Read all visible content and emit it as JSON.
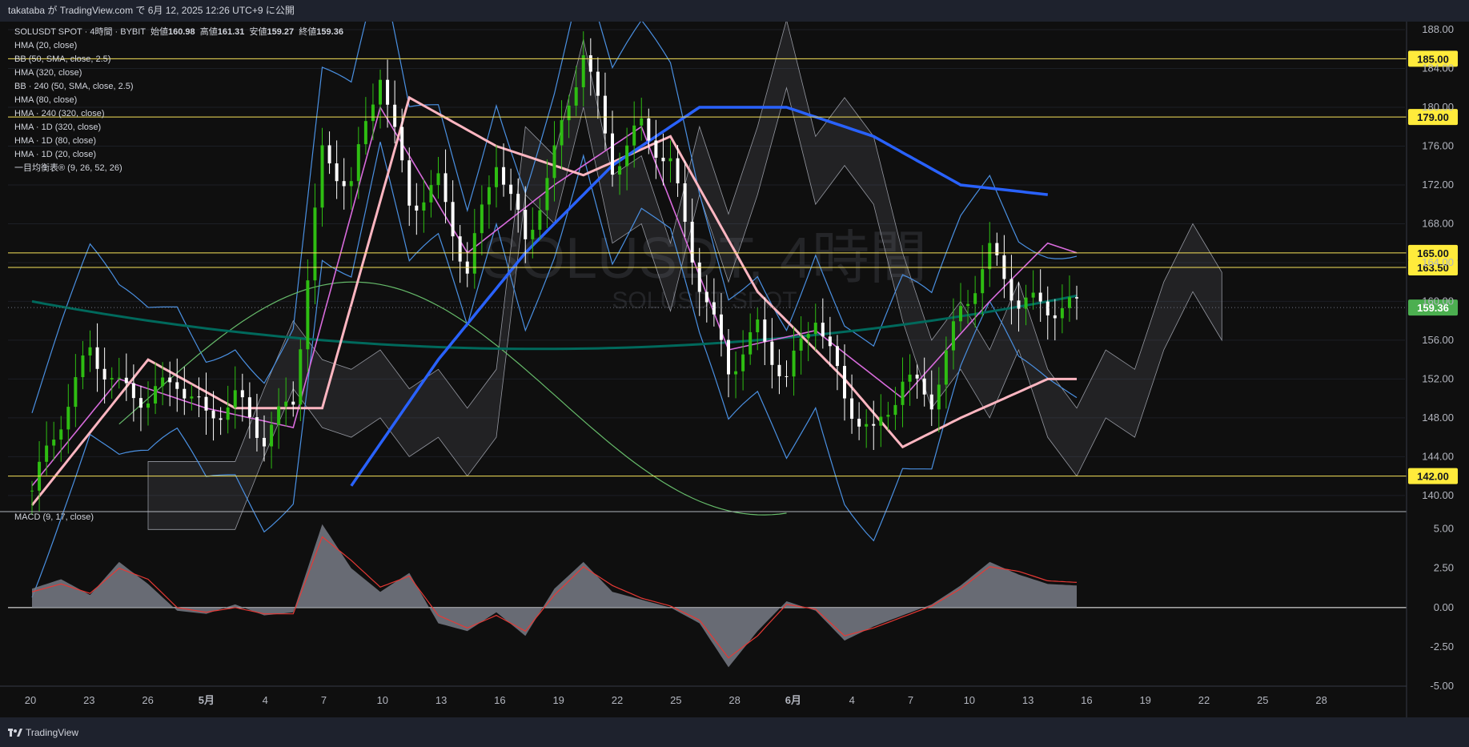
{
  "header": {
    "publish_line": "takataba が TradingView.com で 6月 12, 2025 12:26 UTC+9 に公開"
  },
  "legend": {
    "symbol_line": "SOLUSDT SPOT · 4時間 · BYBIT",
    "open_label": "始値",
    "open": "160.98",
    "high_label": "高値",
    "high": "161.31",
    "low_label": "安値",
    "low": "159.27",
    "close_label": "終値",
    "close": "159.36",
    "indicators": [
      "HMA (20, close)",
      "BB (50, SMA, close, 2.5)",
      "HMA (320, close)",
      "BB · 240 (50, SMA, close, 2.5)",
      "HMA (80, close)",
      "HMA · 240 (320, close)",
      "HMA · 1D (320, close)",
      "HMA · 1D (80, close)",
      "HMA · 1D (20, close)",
      "一目均衡表® (9, 26, 52, 26)"
    ]
  },
  "watermark": {
    "main": "SOLUSDT, 4時間",
    "sub": "SOLUSDT SPOT"
  },
  "footer": {
    "brand": "TradingView"
  },
  "colors": {
    "up": "#2ebd12",
    "down": "#ffffff",
    "level": "#f7e35b",
    "level_label_bg": "#ffeb3b",
    "last_price_bg": "#4caf50",
    "hma20": "#d86bdc",
    "hma80": "#ffb6c1",
    "hma320": "#2962ff",
    "bb": "#4a90e2",
    "bb240": "#5c8fd6",
    "green": "#66bb6a",
    "teal": "#00695c",
    "macd_fill": "#787b86",
    "signal": "#e53935"
  },
  "chart_data": [
    {
      "type": "candlestick",
      "title": "SOLUSDT SPOT · 4時間 · BYBIT",
      "x_tick_labels": [
        "20",
        "23",
        "26",
        "5月",
        "4",
        "7",
        "10",
        "13",
        "16",
        "19",
        "22",
        "25",
        "28",
        "6月",
        "4",
        "7",
        "10",
        "13",
        "16",
        "19",
        "22",
        "25",
        "28"
      ],
      "y_tick_labels": [
        "188.00",
        "184.00",
        "180.00",
        "176.00",
        "172.00",
        "168.00",
        "164.00",
        "160.00",
        "156.00",
        "152.00",
        "148.00",
        "144.00",
        "140.00"
      ],
      "ylim": [
        139,
        188
      ],
      "horizontal_levels": [
        185.0,
        179.0,
        165.0,
        163.5,
        142.0
      ],
      "horizontal_level_labels": [
        "185.00",
        "179.00",
        "165.00",
        "163.50",
        "142.00"
      ],
      "last_price": 159.36,
      "last_price_label": "159.36",
      "close_path": {
        "x": [
          0,
          2,
          4,
          6,
          8,
          10,
          12,
          14,
          16,
          18,
          20,
          22,
          24,
          26,
          28,
          30,
          32,
          34,
          36,
          38,
          40,
          42,
          44,
          46,
          48,
          50,
          52,
          54,
          56,
          58,
          60,
          62,
          64,
          66,
          68,
          70,
          72
        ],
        "y": [
          140.5,
          148,
          155,
          151,
          150,
          152,
          148,
          150,
          146,
          150,
          175,
          172,
          184,
          170,
          172,
          163,
          175,
          166,
          175,
          186,
          174,
          178,
          174,
          162,
          153,
          157,
          152,
          159,
          150,
          146,
          152,
          150,
          159,
          165,
          160,
          159.4,
          159.36
        ]
      },
      "series": [
        {
          "name": "HMA (20, close)",
          "x": [
            0,
            6,
            12,
            18,
            24,
            30,
            36,
            42,
            48,
            54,
            60,
            66,
            70,
            72
          ],
          "y": [
            141,
            152,
            149,
            147,
            180,
            165,
            172,
            178,
            155,
            157,
            150,
            160,
            166,
            165
          ]
        },
        {
          "name": "HMA (80, close)",
          "x": [
            0,
            8,
            14,
            20,
            26,
            32,
            38,
            44,
            50,
            56,
            60,
            64,
            70,
            72
          ],
          "y": [
            139,
            154,
            149,
            149,
            181,
            176,
            173,
            177,
            161,
            152,
            145,
            148,
            152,
            152
          ]
        },
        {
          "name": "HMA (320, close)",
          "x": [
            22,
            28,
            34,
            40,
            46,
            52,
            58,
            64,
            70
          ],
          "y": [
            141,
            154,
            165,
            174,
            180,
            180,
            177,
            172,
            171
          ]
        }
      ]
    },
    {
      "type": "area",
      "title": "MACD (9, 17, close)",
      "y_tick_labels": [
        "5.00",
        "2.50",
        "0.00",
        "-2.50",
        "-5.00"
      ],
      "ylim": [
        -5,
        6
      ],
      "series": [
        {
          "name": "MACD (9, 17, close)",
          "x": [
            0,
            2,
            4,
            6,
            8,
            10,
            12,
            14,
            16,
            18,
            20,
            22,
            24,
            26,
            28,
            30,
            32,
            34,
            36,
            38,
            40,
            42,
            44,
            46,
            48,
            50,
            52,
            54,
            56,
            58,
            60,
            62,
            64,
            66,
            68,
            70,
            72
          ],
          "y": [
            1.2,
            1.8,
            0.8,
            2.9,
            1.5,
            -0.2,
            -0.4,
            0.2,
            -0.5,
            -0.3,
            5.3,
            2.5,
            1.0,
            2.2,
            -1.0,
            -1.5,
            -0.3,
            -1.8,
            1.2,
            2.9,
            1.0,
            0.5,
            0.0,
            -1.0,
            -3.8,
            -1.5,
            0.4,
            -0.2,
            -2.1,
            -1.2,
            -0.5,
            0.2,
            1.4,
            2.9,
            2.1,
            1.5,
            1.4
          ]
        },
        {
          "name": "signal",
          "x": [
            0,
            2,
            4,
            6,
            8,
            10,
            12,
            14,
            16,
            18,
            20,
            22,
            24,
            26,
            28,
            30,
            32,
            34,
            36,
            38,
            40,
            42,
            44,
            46,
            48,
            50,
            52,
            54,
            56,
            58,
            60,
            62,
            64,
            66,
            68,
            70,
            72
          ],
          "y": [
            1.0,
            1.5,
            0.9,
            2.5,
            1.8,
            0.0,
            -0.3,
            0.0,
            -0.4,
            -0.4,
            4.5,
            3.0,
            1.3,
            2.0,
            -0.5,
            -1.3,
            -0.5,
            -1.5,
            0.8,
            2.6,
            1.4,
            0.6,
            0.1,
            -0.8,
            -3.2,
            -1.8,
            0.2,
            -0.1,
            -1.8,
            -1.3,
            -0.6,
            0.1,
            1.2,
            2.6,
            2.3,
            1.7,
            1.6
          ]
        }
      ]
    }
  ]
}
